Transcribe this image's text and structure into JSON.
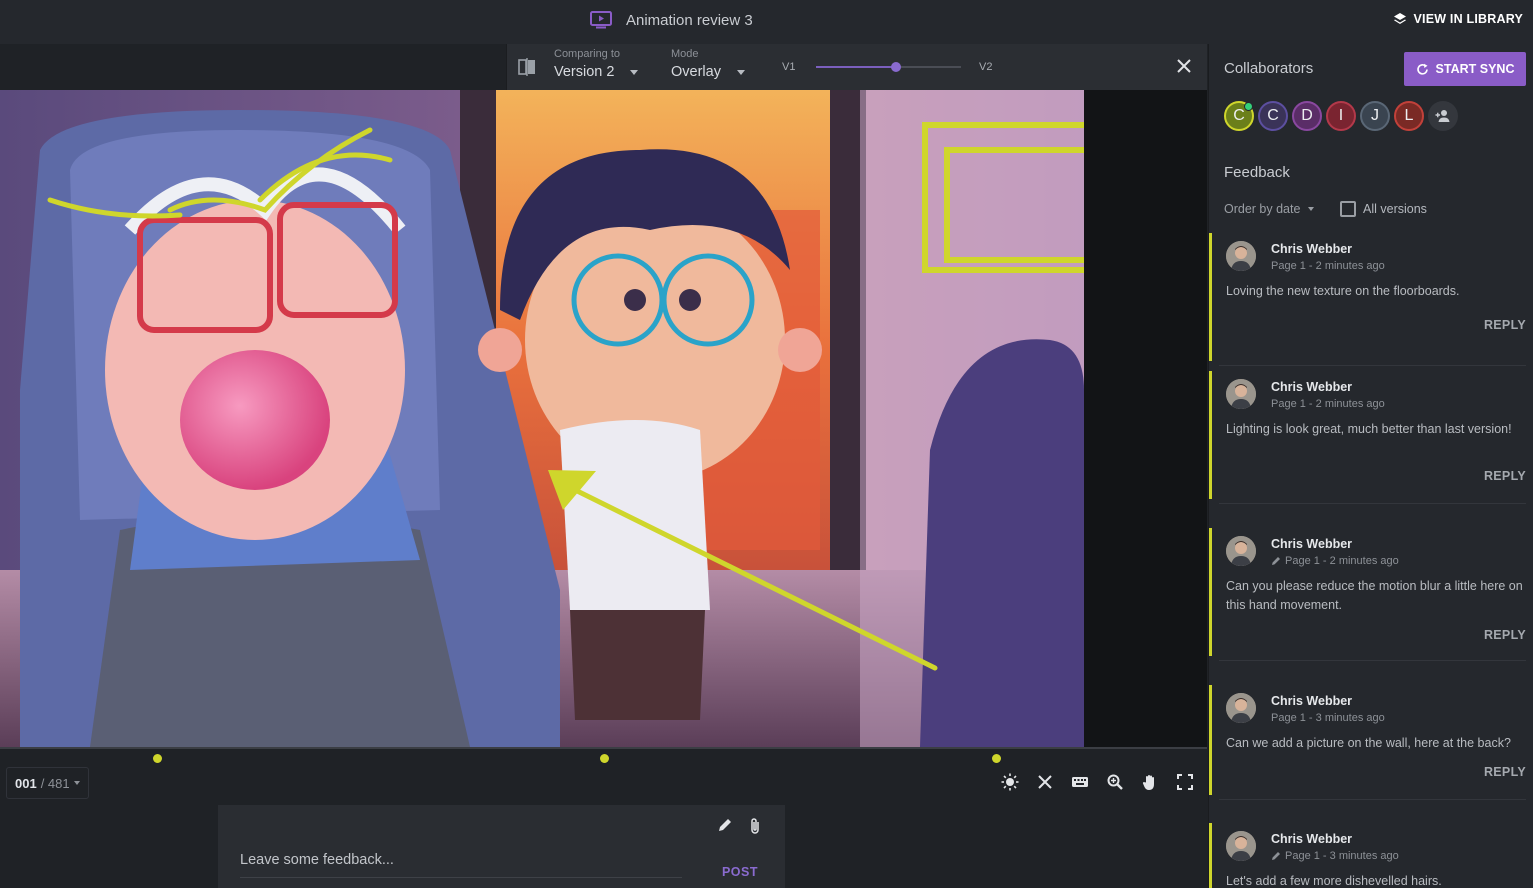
{
  "header": {
    "title": "Animation review 3",
    "title_icon": "tv-play-icon",
    "library_button": "VIEW IN LIBRARY"
  },
  "compare": {
    "comparing_label": "Comparing to",
    "comparing_value": "Version 2",
    "mode_label": "Mode",
    "mode_value": "Overlay",
    "v1_label": "V1",
    "v2_label": "V2",
    "slider_value": 0.55
  },
  "viewer": {
    "frame_current": "001",
    "frame_total": "/ 481",
    "marker_positions": [
      0.13,
      0.5,
      0.825
    ],
    "annotation_color": "#cfd62c"
  },
  "toolbar": {
    "tools": [
      "brightness-icon",
      "compare-off-icon",
      "keyboard-icon",
      "zoom-icon",
      "pan-hand-icon",
      "fullscreen-icon"
    ]
  },
  "composer": {
    "placeholder": "Leave some feedback...",
    "post_label": "POST"
  },
  "collaborators": {
    "title": "Collaborators",
    "sync_label": "START SYNC",
    "people": [
      {
        "initial": "C",
        "color": "#6b7f1a",
        "ring": "#cfd62c",
        "online": true
      },
      {
        "initial": "C",
        "color": "#3a3358",
        "ring": "#5c4fa0",
        "online": false
      },
      {
        "initial": "D",
        "color": "#5a2d67",
        "ring": "#8a48a0",
        "online": false
      },
      {
        "initial": "I",
        "color": "#7a2430",
        "ring": "#b3394a",
        "online": false
      },
      {
        "initial": "J",
        "color": "#3a4450",
        "ring": "#5a6776",
        "online": false
      },
      {
        "initial": "L",
        "color": "#7a2a25",
        "ring": "#c2413a",
        "online": false
      }
    ]
  },
  "feedback": {
    "title": "Feedback",
    "order_label": "Order by date",
    "all_versions_label": "All versions",
    "reply_label": "REPLY",
    "comments": [
      {
        "name": "Chris Webber",
        "meta": "Page 1 - 2 minutes ago",
        "drawn": false,
        "text": "Loving the new texture on the floorboards."
      },
      {
        "name": "Chris Webber",
        "meta": "Page 1 - 2 minutes ago",
        "drawn": false,
        "text": "Lighting is look great, much better than last version!"
      },
      {
        "name": "Chris Webber",
        "meta": "Page 1 - 2 minutes ago",
        "drawn": true,
        "text": "Can you please reduce the motion blur a little here on this hand movement."
      },
      {
        "name": "Chris Webber",
        "meta": "Page 1 - 3 minutes ago",
        "drawn": false,
        "text": "Can we add a picture on the wall, here at the back?"
      },
      {
        "name": "Chris Webber",
        "meta": "Page 1 - 3 minutes ago",
        "drawn": true,
        "text": "Let's add a few more dishevelled hairs."
      }
    ]
  }
}
